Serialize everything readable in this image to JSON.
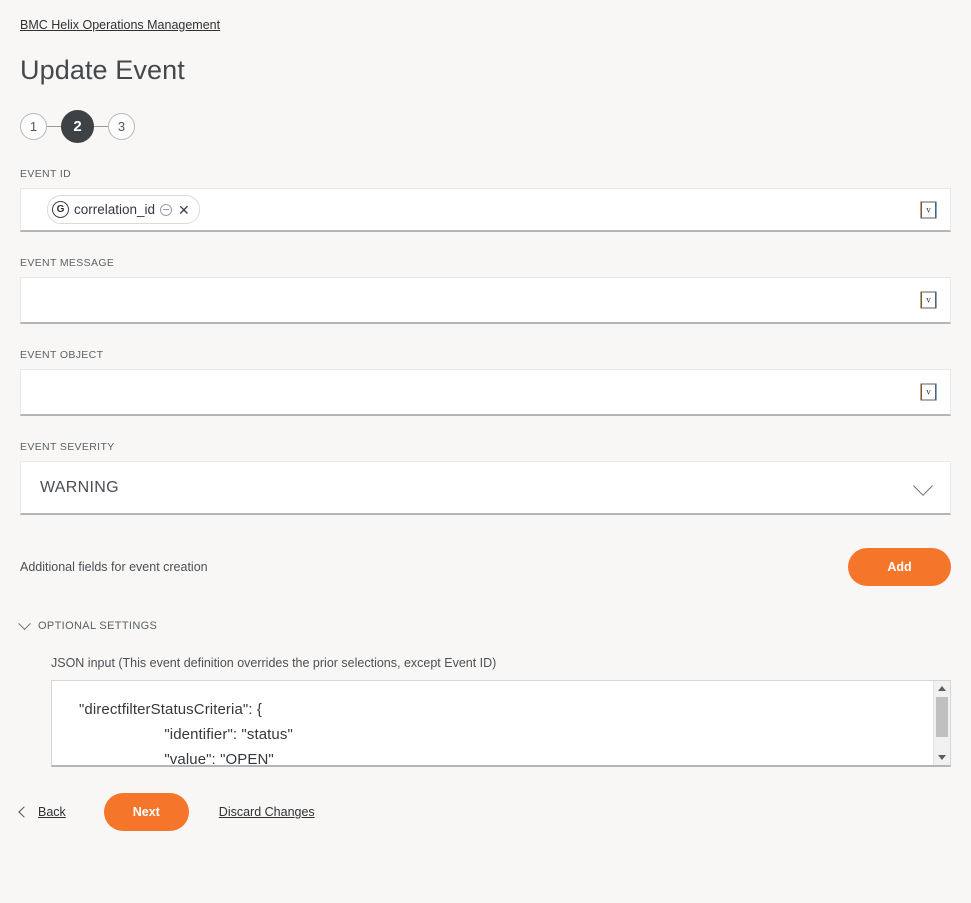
{
  "breadcrumb": {
    "label": "BMC Helix Operations Management"
  },
  "page": {
    "title": "Update Event"
  },
  "stepper": {
    "steps": [
      {
        "label": "1",
        "active": false
      },
      {
        "label": "2",
        "active": true
      },
      {
        "label": "3",
        "active": false
      }
    ]
  },
  "fields": {
    "event_id": {
      "label": "EVENT ID",
      "value": "",
      "expander_glyph": "v",
      "chip": {
        "badge": "G",
        "label": "correlation_id",
        "minus_icon": "circle-minus-icon",
        "close_glyph": "✕"
      }
    },
    "event_message": {
      "label": "EVENT MESSAGE",
      "value": "",
      "expander_glyph": "v"
    },
    "event_object": {
      "label": "EVENT OBJECT",
      "value": "",
      "expander_glyph": "v"
    },
    "event_severity": {
      "label": "EVENT SEVERITY",
      "value": "WARNING",
      "options": [
        "WARNING"
      ]
    }
  },
  "additional": {
    "text": "Additional fields for event creation",
    "add_label": "Add"
  },
  "optional_settings": {
    "label": "OPTIONAL SETTINGS",
    "caption": "JSON input (This event definition overrides the prior selections, except Event ID)",
    "json_value": "\"directfilterStatusCriteria\": {\n                    \"identifier\": \"status\"\n                    \"value\": \"OPEN\""
  },
  "footer": {
    "back_label": "Back",
    "next_label": "Next",
    "discard_label": "Discard Changes"
  },
  "colors": {
    "accent_orange": "#f5752a",
    "active_step": "#3f4245",
    "page_background": "#f8f7f5"
  }
}
